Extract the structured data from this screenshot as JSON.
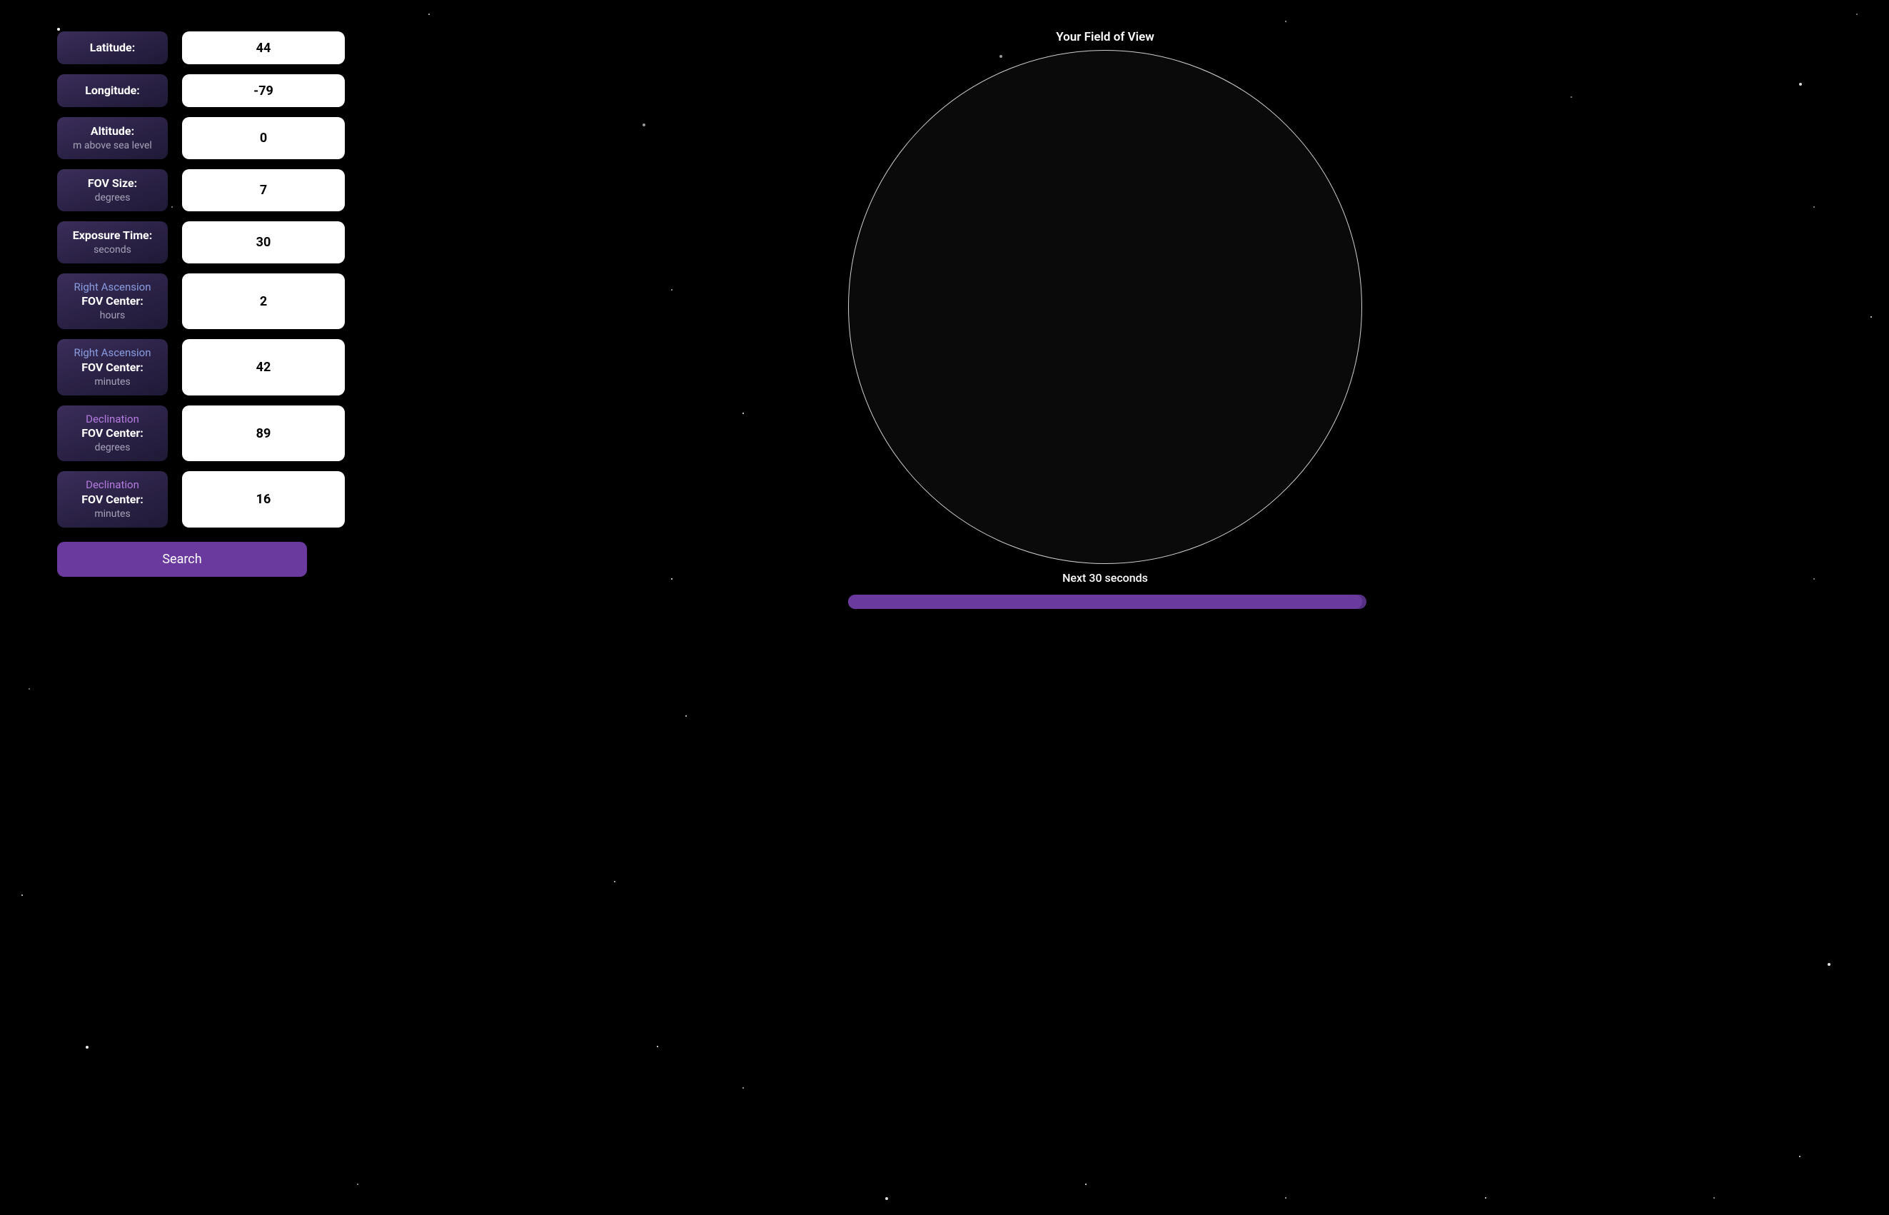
{
  "form": {
    "fields": [
      {
        "supertitle": "",
        "supertitle_class": "",
        "title": "Latitude:",
        "subtitle": "",
        "value": "44"
      },
      {
        "supertitle": "",
        "supertitle_class": "",
        "title": "Longitude:",
        "subtitle": "",
        "value": "-79"
      },
      {
        "supertitle": "",
        "supertitle_class": "",
        "title": "Altitude:",
        "subtitle": "m above sea level",
        "value": "0"
      },
      {
        "supertitle": "",
        "supertitle_class": "",
        "title": "FOV Size:",
        "subtitle": "degrees",
        "value": "7"
      },
      {
        "supertitle": "",
        "supertitle_class": "",
        "title": "Exposure Time:",
        "subtitle": "seconds",
        "value": "30"
      },
      {
        "supertitle": "Right Ascension",
        "supertitle_class": "ra",
        "title": "FOV Center:",
        "subtitle": "hours",
        "value": "2"
      },
      {
        "supertitle": "Right Ascension",
        "supertitle_class": "ra",
        "title": "FOV Center:",
        "subtitle": "minutes",
        "value": "42"
      },
      {
        "supertitle": "Declination",
        "supertitle_class": "dec",
        "title": "FOV Center:",
        "subtitle": "degrees",
        "value": "89"
      },
      {
        "supertitle": "Declination",
        "supertitle_class": "dec",
        "title": "FOV Center:",
        "subtitle": "minutes",
        "value": "16"
      }
    ],
    "search_label": "Search"
  },
  "view": {
    "title": "Your Field of View",
    "progress_label": "Next 30 seconds",
    "progress_percent": 98
  },
  "colors": {
    "panel_accent": "#6a3a9e",
    "ra_text": "#8a9de0",
    "dec_text": "#b57be0"
  }
}
